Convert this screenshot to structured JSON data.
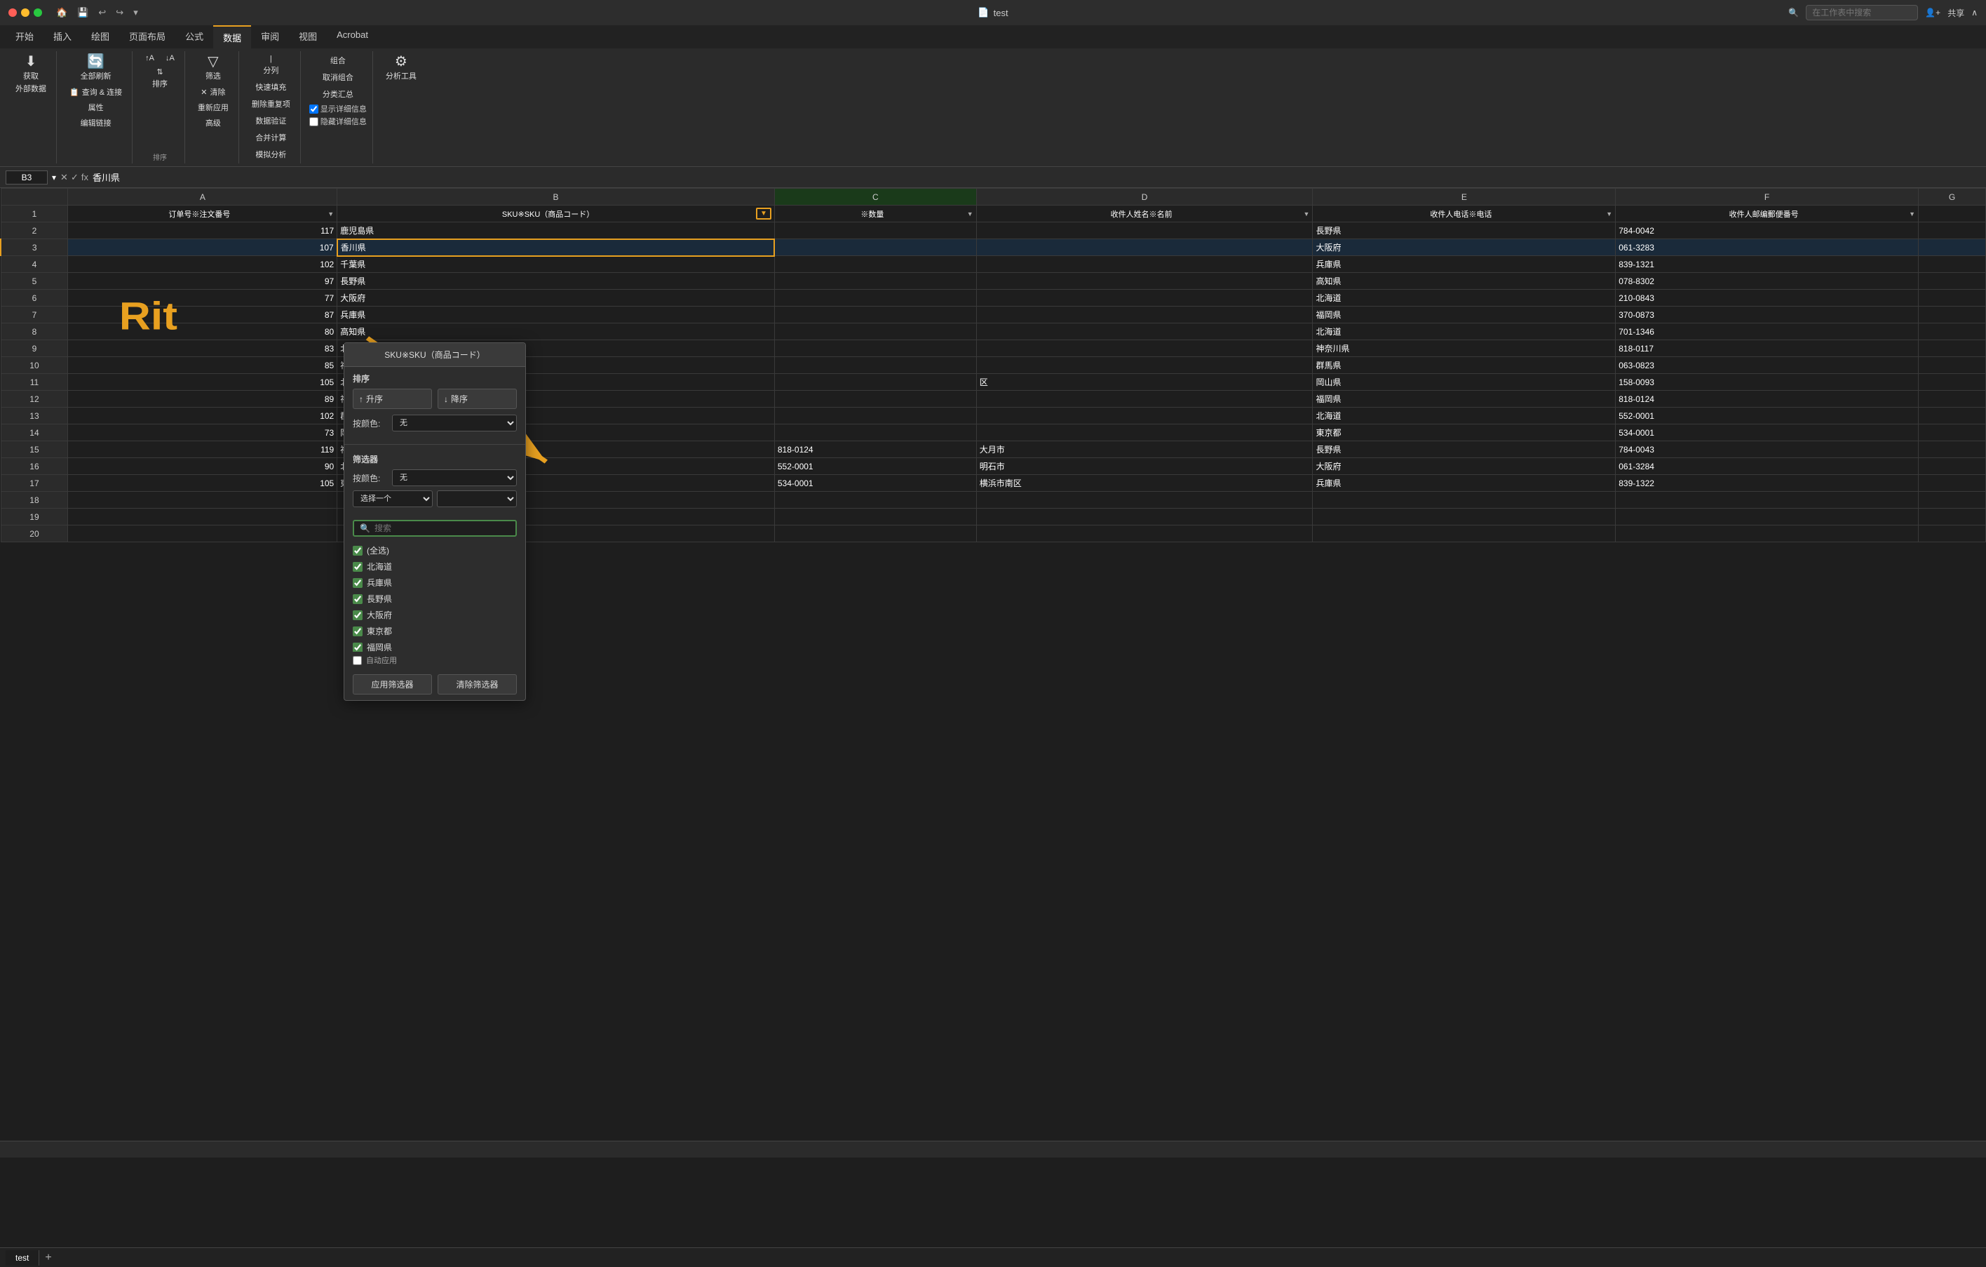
{
  "titlebar": {
    "title": "test",
    "file_icon": "📄",
    "search_placeholder": "在工作表中搜索",
    "share_label": "共享"
  },
  "ribbon": {
    "tabs": [
      "开始",
      "插入",
      "绘图",
      "页面布局",
      "公式",
      "数据",
      "审阅",
      "视图",
      "Acrobat"
    ],
    "active_tab": "数据",
    "groups": {
      "get_external": {
        "label": "获取\n外部数据",
        "icon": "⬇"
      },
      "refresh_all": {
        "label": "全部刷新"
      },
      "connections": {
        "query_connect": "查询 & 连接",
        "properties": "属性",
        "edit_links": "编辑链接"
      },
      "sort": {
        "label": "排序",
        "asc_icon": "↑A",
        "desc_icon": "↓A"
      },
      "filter": {
        "label": "筛选"
      },
      "clear": "清除",
      "reapply": "重新应用",
      "advanced": "高级",
      "split": "分列",
      "fill": "快速\n填充",
      "remove_dup": "删除\n重复项",
      "validate": "数据验证",
      "merge": "合并\n计算",
      "analysis": "模拟分析",
      "group": "组合",
      "ungroup": "取消组合",
      "subtotal": "分类\n汇总",
      "show_detail": "显示详细信息",
      "hide_detail": "隐藏详细信息",
      "analyze_tool": "分析\n工具"
    }
  },
  "formula_bar": {
    "cell_ref": "B3",
    "formula": "香川県"
  },
  "columns": {
    "row_header": "",
    "A": "A",
    "B": "B",
    "C": "C",
    "D": "D",
    "E": "E",
    "F": "F",
    "G": "G"
  },
  "headers": {
    "A": "订单号※注文番号",
    "B": "SKU※SKU（商品コード）",
    "C": "※数量",
    "D": "收件人姓名※名前",
    "E": "收件人电话※电话",
    "F": "收件人邮编郵便番号"
  },
  "rows": [
    {
      "row": "1",
      "A": "订单号※注文番号",
      "B": "SKU※SKU（商品コード）",
      "C": "※数量",
      "D": "收件人姓名※名前",
      "E": "收件人电话※电话",
      "F": "收件人邮编郵便番号",
      "is_header": true
    },
    {
      "row": "2",
      "A": "117",
      "B": "鹿児島県",
      "C": "",
      "D": "",
      "E": "長野県",
      "F": "784-0042"
    },
    {
      "row": "3",
      "A": "107",
      "B": "香川県",
      "C": "",
      "D": "",
      "E": "大阪府",
      "F": "061-3283",
      "selected": true
    },
    {
      "row": "4",
      "A": "102",
      "B": "千葉県",
      "C": "",
      "D": "",
      "E": "兵庫県",
      "F": "839-1321"
    },
    {
      "row": "5",
      "A": "97",
      "B": "長野県",
      "C": "",
      "D": "",
      "E": "高知県",
      "F": "078-8302"
    },
    {
      "row": "6",
      "A": "77",
      "B": "大阪府",
      "C": "",
      "D": "",
      "E": "北海道",
      "F": "210-0843"
    },
    {
      "row": "7",
      "A": "87",
      "B": "兵庫県",
      "C": "",
      "D": "",
      "E": "福岡県",
      "F": "370-0873"
    },
    {
      "row": "8",
      "A": "80",
      "B": "高知県",
      "C": "",
      "D": "",
      "E": "北海道",
      "F": "701-1346"
    },
    {
      "row": "9",
      "A": "83",
      "B": "北海道",
      "C": "",
      "D": "",
      "E": "神奈川県",
      "F": "818-0117"
    },
    {
      "row": "10",
      "A": "85",
      "B": "福岡県",
      "C": "",
      "D": "",
      "E": "群馬県",
      "F": "063-0823"
    },
    {
      "row": "11",
      "A": "105",
      "B": "北海道",
      "C": "",
      "D": "区",
      "E": "岡山県",
      "F": "158-0093"
    },
    {
      "row": "12",
      "A": "89",
      "B": "神奈川県",
      "C": "",
      "D": "",
      "E": "福岡県",
      "F": "818-0124"
    },
    {
      "row": "13",
      "A": "102",
      "B": "群馬県",
      "C": "",
      "D": "",
      "E": "北海道",
      "F": "552-0001"
    },
    {
      "row": "14",
      "A": "73",
      "B": "岡山県",
      "C": "",
      "D": "",
      "E": "東京都",
      "F": "534-0001"
    },
    {
      "row": "15",
      "A": "119",
      "B": "福岡県",
      "C": "818-0124",
      "D": "大月市",
      "E": "長野県",
      "F": "784-0043"
    },
    {
      "row": "16",
      "A": "90",
      "B": "北海道",
      "C": "552-0001",
      "D": "明石市",
      "E": "大阪府",
      "F": "061-3284"
    },
    {
      "row": "17",
      "A": "105",
      "B": "東京都",
      "C": "534-0001",
      "D": "横浜市南区",
      "E": "兵庫県",
      "F": "839-1322"
    },
    {
      "row": "18",
      "A": "",
      "B": "",
      "C": "",
      "D": "",
      "E": "",
      "F": ""
    },
    {
      "row": "19",
      "A": "",
      "B": "",
      "C": "",
      "D": "",
      "E": "",
      "F": ""
    },
    {
      "row": "20",
      "A": "",
      "B": "",
      "C": "",
      "D": "",
      "E": "",
      "F": ""
    }
  ],
  "filter_dropdown": {
    "title": "SKU※SKU（商品コード）",
    "sort_section": "排序",
    "sort_asc": "升序",
    "sort_desc": "降序",
    "color_label": "按颜色:",
    "color_value_1": "无",
    "filter_section": "筛选器",
    "color_label_2": "按颜色:",
    "color_value_2": "无",
    "operator_label": "选择一个",
    "search_placeholder": "搜索",
    "select_all": "(全选)",
    "items": [
      "北海道",
      "兵庫県",
      "長野県",
      "大阪府",
      "東京都",
      "福岡県"
    ],
    "auto_apply": "自动应用",
    "apply_btn": "应用筛选器",
    "clear_btn": "清除筛选器"
  },
  "annotation": {
    "arrow_label": "Rit"
  },
  "sheet_tab": "test",
  "status_bar": ""
}
